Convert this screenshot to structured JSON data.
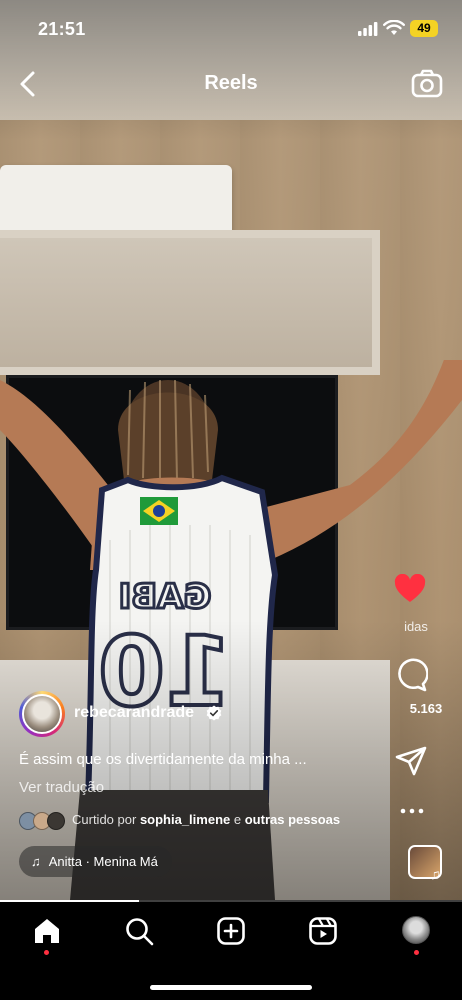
{
  "status_bar": {
    "time": "21:51",
    "battery": "49",
    "battery_color": "#f4d224"
  },
  "header": {
    "title": "Reels",
    "back_icon": "chevron-left-icon",
    "camera_icon": "camera-icon"
  },
  "actions": {
    "like_count": "idas",
    "like_color": "#ff3040",
    "comment_count": "5.163"
  },
  "post": {
    "username": "rebecarandrade",
    "caption": "É assim que os divertidamente da minha ...",
    "translate_label": "Ver tradução",
    "liked_prefix": "Curtido por",
    "liked_user": "sophia_limene",
    "liked_connector": "e",
    "liked_others": "outras pessoas",
    "audio": "Anitta · Menina Má"
  },
  "video": {
    "jersey_name": "GABI",
    "jersey_number": "10"
  },
  "nav": {
    "items": [
      "home-icon",
      "search-icon",
      "create-icon",
      "reels-icon",
      "profile-avatar"
    ],
    "progress": 0.3
  }
}
